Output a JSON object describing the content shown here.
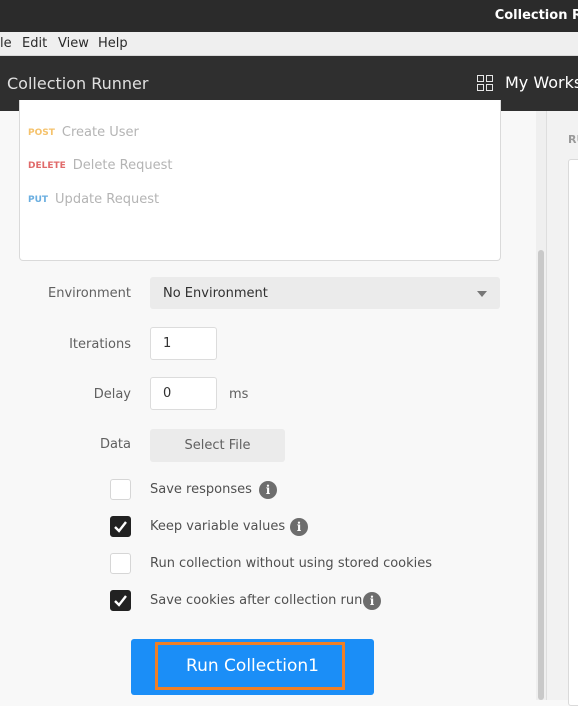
{
  "window": {
    "title": "Collection R"
  },
  "menu": {
    "file": "le",
    "edit": "Edit",
    "view": "View",
    "help": "Help"
  },
  "header": {
    "app_title": "Collection Runner",
    "workspace_label": "My Works",
    "workspace_icon": "grid-icon"
  },
  "requests": [
    {
      "method": "POST",
      "name": "Create User",
      "color": "#f5c26b"
    },
    {
      "method": "DELETE",
      "name": "Delete Request",
      "color": "#e06a6a"
    },
    {
      "method": "PUT",
      "name": "Update Request",
      "color": "#6aaee0"
    }
  ],
  "form": {
    "environment_label": "Environment",
    "environment_value": "No Environment",
    "iterations_label": "Iterations",
    "iterations_value": "1",
    "delay_label": "Delay",
    "delay_value": "0",
    "delay_unit": "ms",
    "data_label": "Data",
    "select_file": "Select File"
  },
  "options": [
    {
      "label": "Save responses",
      "checked": false,
      "info": true
    },
    {
      "label": "Keep variable values",
      "checked": true,
      "info": true
    },
    {
      "label": "Run collection without using stored cookies",
      "checked": false,
      "info": false
    },
    {
      "label": "Save cookies after collection run",
      "checked": true,
      "info": true
    }
  ],
  "run_button": {
    "label": "Run Collection1",
    "color": "#1b8ef7",
    "highlight_color": "#f07f26"
  },
  "right_panel": {
    "heading": "RU"
  }
}
